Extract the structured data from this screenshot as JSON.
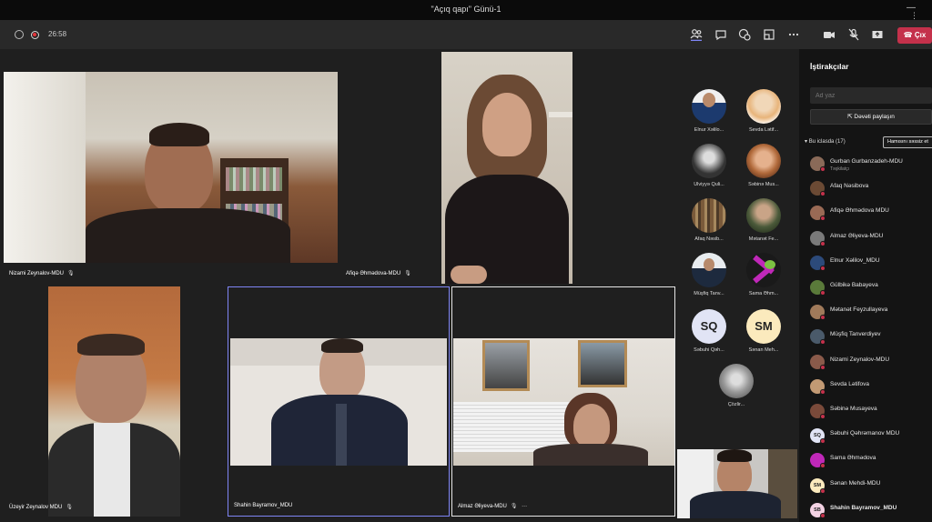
{
  "window": {
    "title": "\"Açıq qapı\" Günü-1",
    "minimize": "—"
  },
  "toolbar": {
    "timer": "26:58",
    "leave_label": "Çıx",
    "icons": [
      "shield-icon",
      "record-icon",
      "people-icon",
      "chat-icon",
      "react-icon",
      "rooms-icon",
      "more-icon",
      "camera-icon",
      "mic-off-icon",
      "share-icon",
      "phone-icon"
    ]
  },
  "stage": {
    "tiles": [
      {
        "name": "Nizami Zeynalov-MDU"
      },
      {
        "name": "Afiqə Əhmədova-MDU"
      },
      {
        "name": "Üzeyir Zeynalov MDU"
      },
      {
        "name": "Shahin Bayramov_MDU"
      },
      {
        "name": "Almaz Əliyeva-MDU",
        "more": "···"
      }
    ],
    "gallery": [
      {
        "name": "Elnur Xəlilo..."
      },
      {
        "name": "Sevda Lətif..."
      },
      {
        "name": "Ulviyyə Quli..."
      },
      {
        "name": "Səbinə Mus..."
      },
      {
        "name": "Afaq Nəsib..."
      },
      {
        "name": "Mətanət Fe..."
      },
      {
        "name": "Müşfiq Tanv..."
      },
      {
        "name": "Sama Əhm..."
      },
      {
        "name": "Səbuhi Qəh...",
        "initials": "SQ"
      },
      {
        "name": "Sənan Meh...",
        "initials": "SM"
      },
      {
        "name": "Çözlir..."
      }
    ]
  },
  "panel": {
    "title": "İştirakçılar",
    "more": "⋮",
    "search_placeholder": "Ad yaz",
    "invite_label": "Dəvəti paylaşın",
    "section_label": "Bu iclasda (17)",
    "mute_all_label": "Hamısını səssiz et",
    "participants": [
      {
        "name": "Gurban Gurbanzadeh-MDU",
        "role": "Təşkilatçı"
      },
      {
        "name": "Afaq Nəsibova"
      },
      {
        "name": "Afiqə Əhmədova MDU"
      },
      {
        "name": "Almaz Əliyeva-MDU"
      },
      {
        "name": "Elnur Xəlilov_MDU"
      },
      {
        "name": "Gülbikə Babayeva"
      },
      {
        "name": "Mətanət Feyzullayeva"
      },
      {
        "name": "Müşfiq Tanverdiyev"
      },
      {
        "name": "Nizami Zeynalov-MDU"
      },
      {
        "name": "Sevda Lətifova"
      },
      {
        "name": "Səbinə Musayeva"
      },
      {
        "name": "Səbuhi Qəhrəmanov MDU",
        "initials": "SQ"
      },
      {
        "name": "Sama Əhmədova"
      },
      {
        "name": "Sənan Mehdi-MDU",
        "initials": "SM"
      },
      {
        "name": "Shahin Bayramov_MDU",
        "initials": "SB"
      }
    ]
  }
}
